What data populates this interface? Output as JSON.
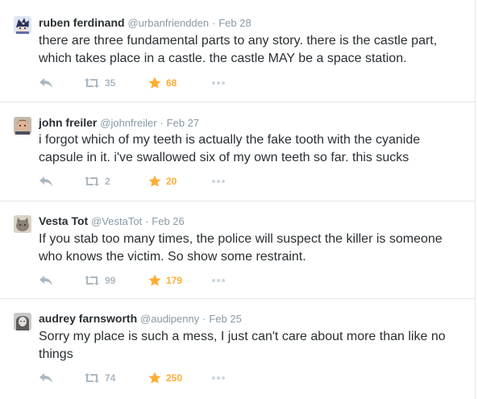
{
  "colors": {
    "muted": "#8899a6",
    "icon": "#aab8c2",
    "favorite": "#ffac33",
    "border": "#e1e8ed",
    "text": "#292f33"
  },
  "tweets": [
    {
      "fullname": "ruben ferdinand",
      "handle": "@urbanfriendden",
      "dot": "·",
      "time": "Feb 28",
      "text": "there are three fundamental parts to any story. there is the castle part, which takes place in a castle. the castle MAY be a space station.",
      "retweets": "35",
      "favorites": "68",
      "avatar_icon": "anime-character-avatar"
    },
    {
      "fullname": "john freiler",
      "handle": "@johnfreiler",
      "dot": "·",
      "time": "Feb 27",
      "text": "i forgot which of my teeth is actually the fake tooth with the cyanide capsule in it. i've swallowed six of my own teeth so far. this sucks",
      "retweets": "2",
      "favorites": "20",
      "avatar_icon": "person-photo-avatar"
    },
    {
      "fullname": "Vesta Tot",
      "handle": "@VestaTot",
      "dot": "·",
      "time": "Feb 26",
      "text": "If you stab too many times, the police will suspect the killer is someone who knows the victim. So show some restraint.",
      "retweets": "99",
      "favorites": "179",
      "avatar_icon": "cat-photo-avatar"
    },
    {
      "fullname": "audrey farnsworth",
      "handle": "@audipenny",
      "dot": "·",
      "time": "Feb 25",
      "text": "Sorry my place is such a mess, I just can't care about more than like no things",
      "retweets": "74",
      "favorites": "250",
      "avatar_icon": "person-photo-avatar"
    }
  ]
}
